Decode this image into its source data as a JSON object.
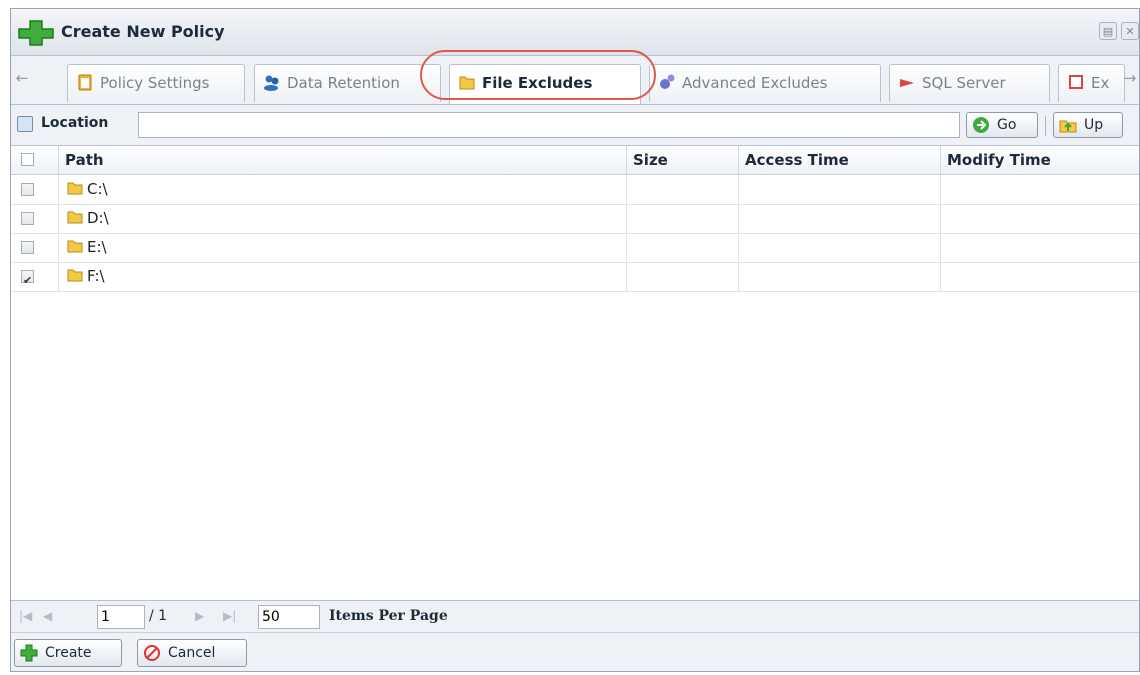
{
  "window": {
    "title": "Create New Policy",
    "title_icon": "green-plus-icon"
  },
  "tabs": [
    {
      "label": "Policy Settings",
      "icon": "clipboard-icon",
      "active": false
    },
    {
      "label": "Data Retention",
      "icon": "users-icon",
      "active": false
    },
    {
      "label": "File Excludes",
      "icon": "folder-icon",
      "active": true
    },
    {
      "label": "Advanced Excludes",
      "icon": "gears-icon",
      "active": false
    },
    {
      "label": "SQL Server",
      "icon": "sql-icon",
      "active": false
    },
    {
      "label": "Ex",
      "icon": "exchange-icon",
      "active": false
    }
  ],
  "location": {
    "label": "Location",
    "value": "",
    "go_label": "Go",
    "up_label": "Up"
  },
  "grid": {
    "columns": [
      "Path",
      "Size",
      "Access Time",
      "Modify Time"
    ],
    "rows": [
      {
        "path": "C:\\",
        "size": "",
        "access_time": "",
        "modify_time": "",
        "checked": false
      },
      {
        "path": "D:\\",
        "size": "",
        "access_time": "",
        "modify_time": "",
        "checked": false
      },
      {
        "path": "E:\\",
        "size": "",
        "access_time": "",
        "modify_time": "",
        "checked": false
      },
      {
        "path": "F:\\",
        "size": "",
        "access_time": "",
        "modify_time": "",
        "checked": true
      }
    ]
  },
  "pager": {
    "current_page": "1",
    "total_pages": "/ 1",
    "items_per_page": "50",
    "items_per_page_label": "Items Per Page"
  },
  "footer": {
    "create_label": "Create",
    "cancel_label": "Cancel"
  },
  "colors": {
    "accent": "#2e9a2e",
    "highlight": "#e0584a",
    "chrome": "#eef1f5"
  }
}
